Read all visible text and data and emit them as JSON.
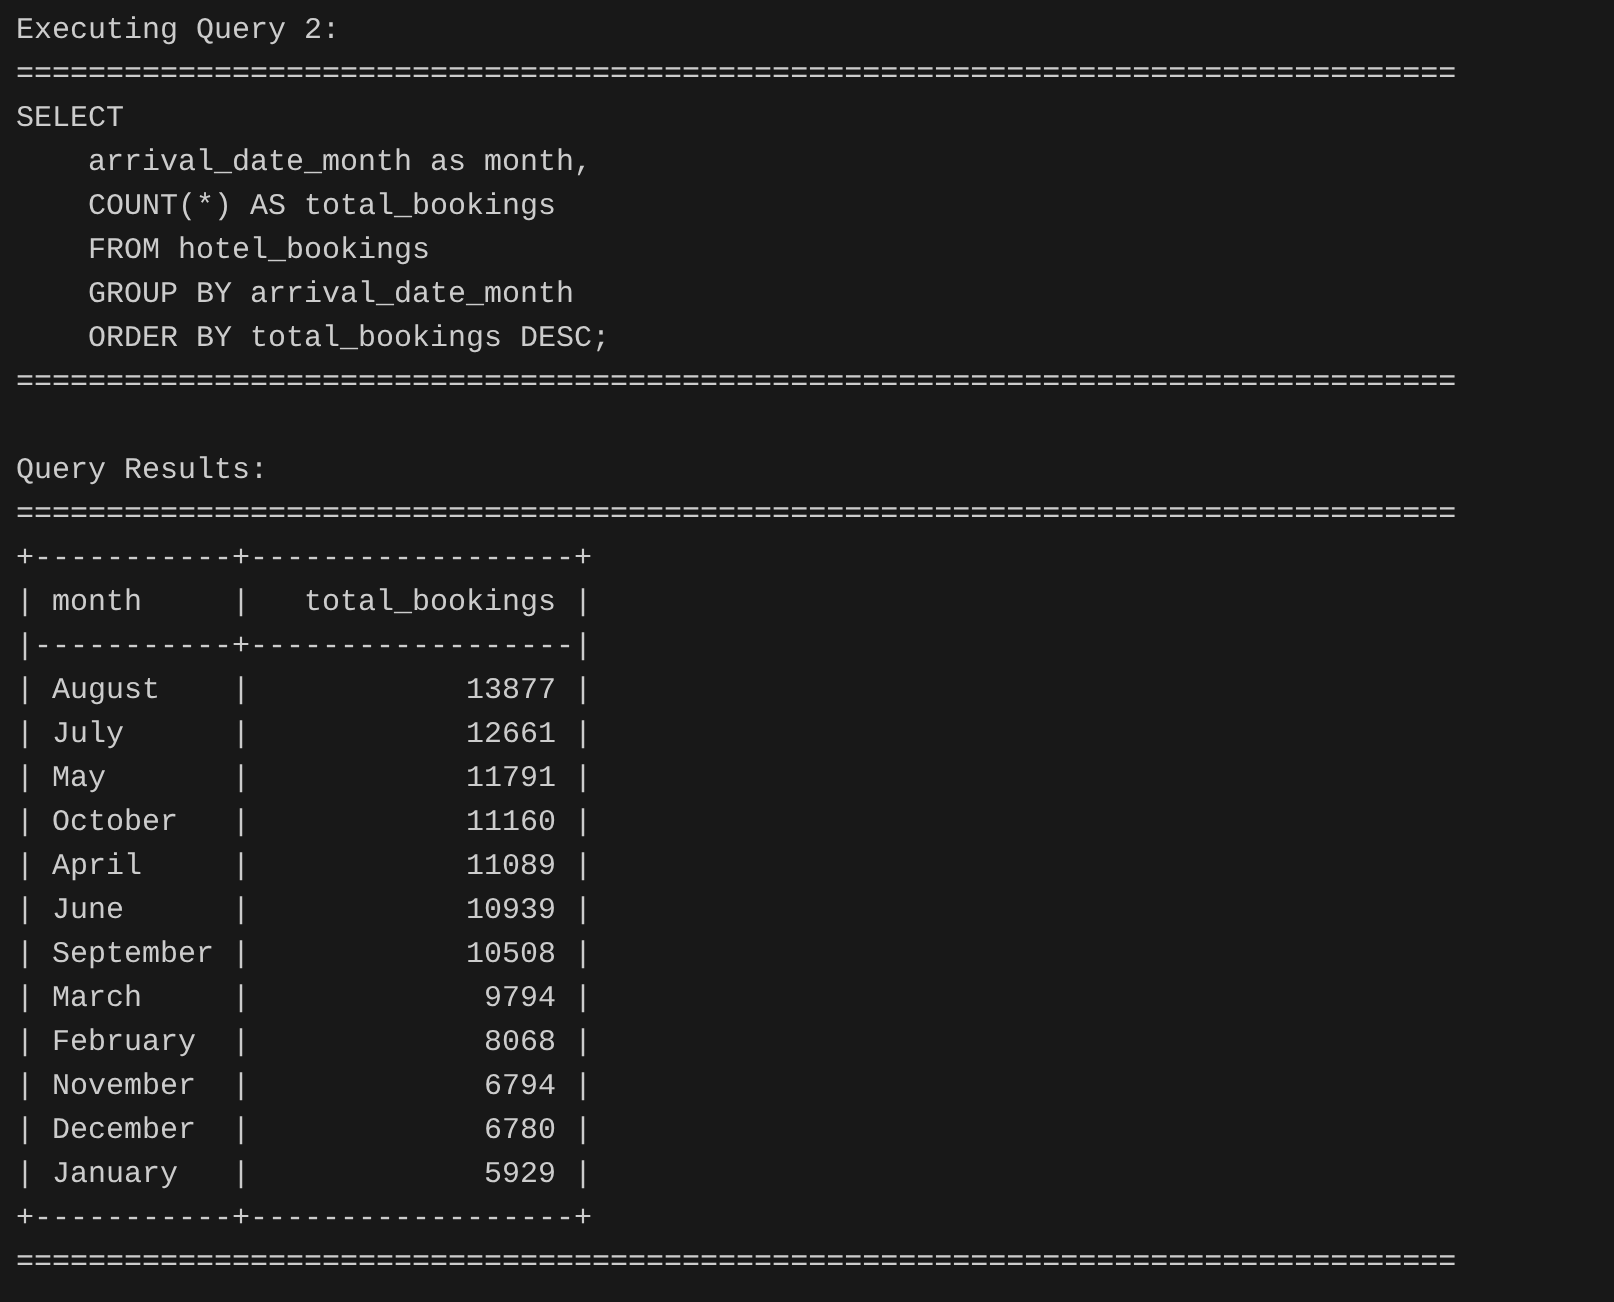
{
  "query_heading": "Executing Query 2:",
  "query_rule_top": "================================================================================",
  "sql_lines": [
    "SELECT",
    "    arrival_date_month as month,",
    "    COUNT(*) AS total_bookings",
    "    FROM hotel_bookings",
    "    GROUP BY arrival_date_month",
    "    ORDER BY total_bookings DESC;"
  ],
  "query_rule_bottom": "================================================================================",
  "results_heading": "Query Results:",
  "results_rule": "================================================================================",
  "table": {
    "top_border": "+-----------+------------------+",
    "header": "| month     |   total_bookings |",
    "header_border": "|-----------+------------------|",
    "rows": [
      "| August    |            13877 |",
      "| July      |            12661 |",
      "| May       |            11791 |",
      "| October   |            11160 |",
      "| April     |            11089 |",
      "| June      |            10939 |",
      "| September |            10508 |",
      "| March     |             9794 |",
      "| February  |             8068 |",
      "| November  |             6794 |",
      "| December  |             6780 |",
      "| January   |             5929 |"
    ],
    "bottom_border": "+-----------+------------------+"
  },
  "final_rule": "================================================================================"
}
